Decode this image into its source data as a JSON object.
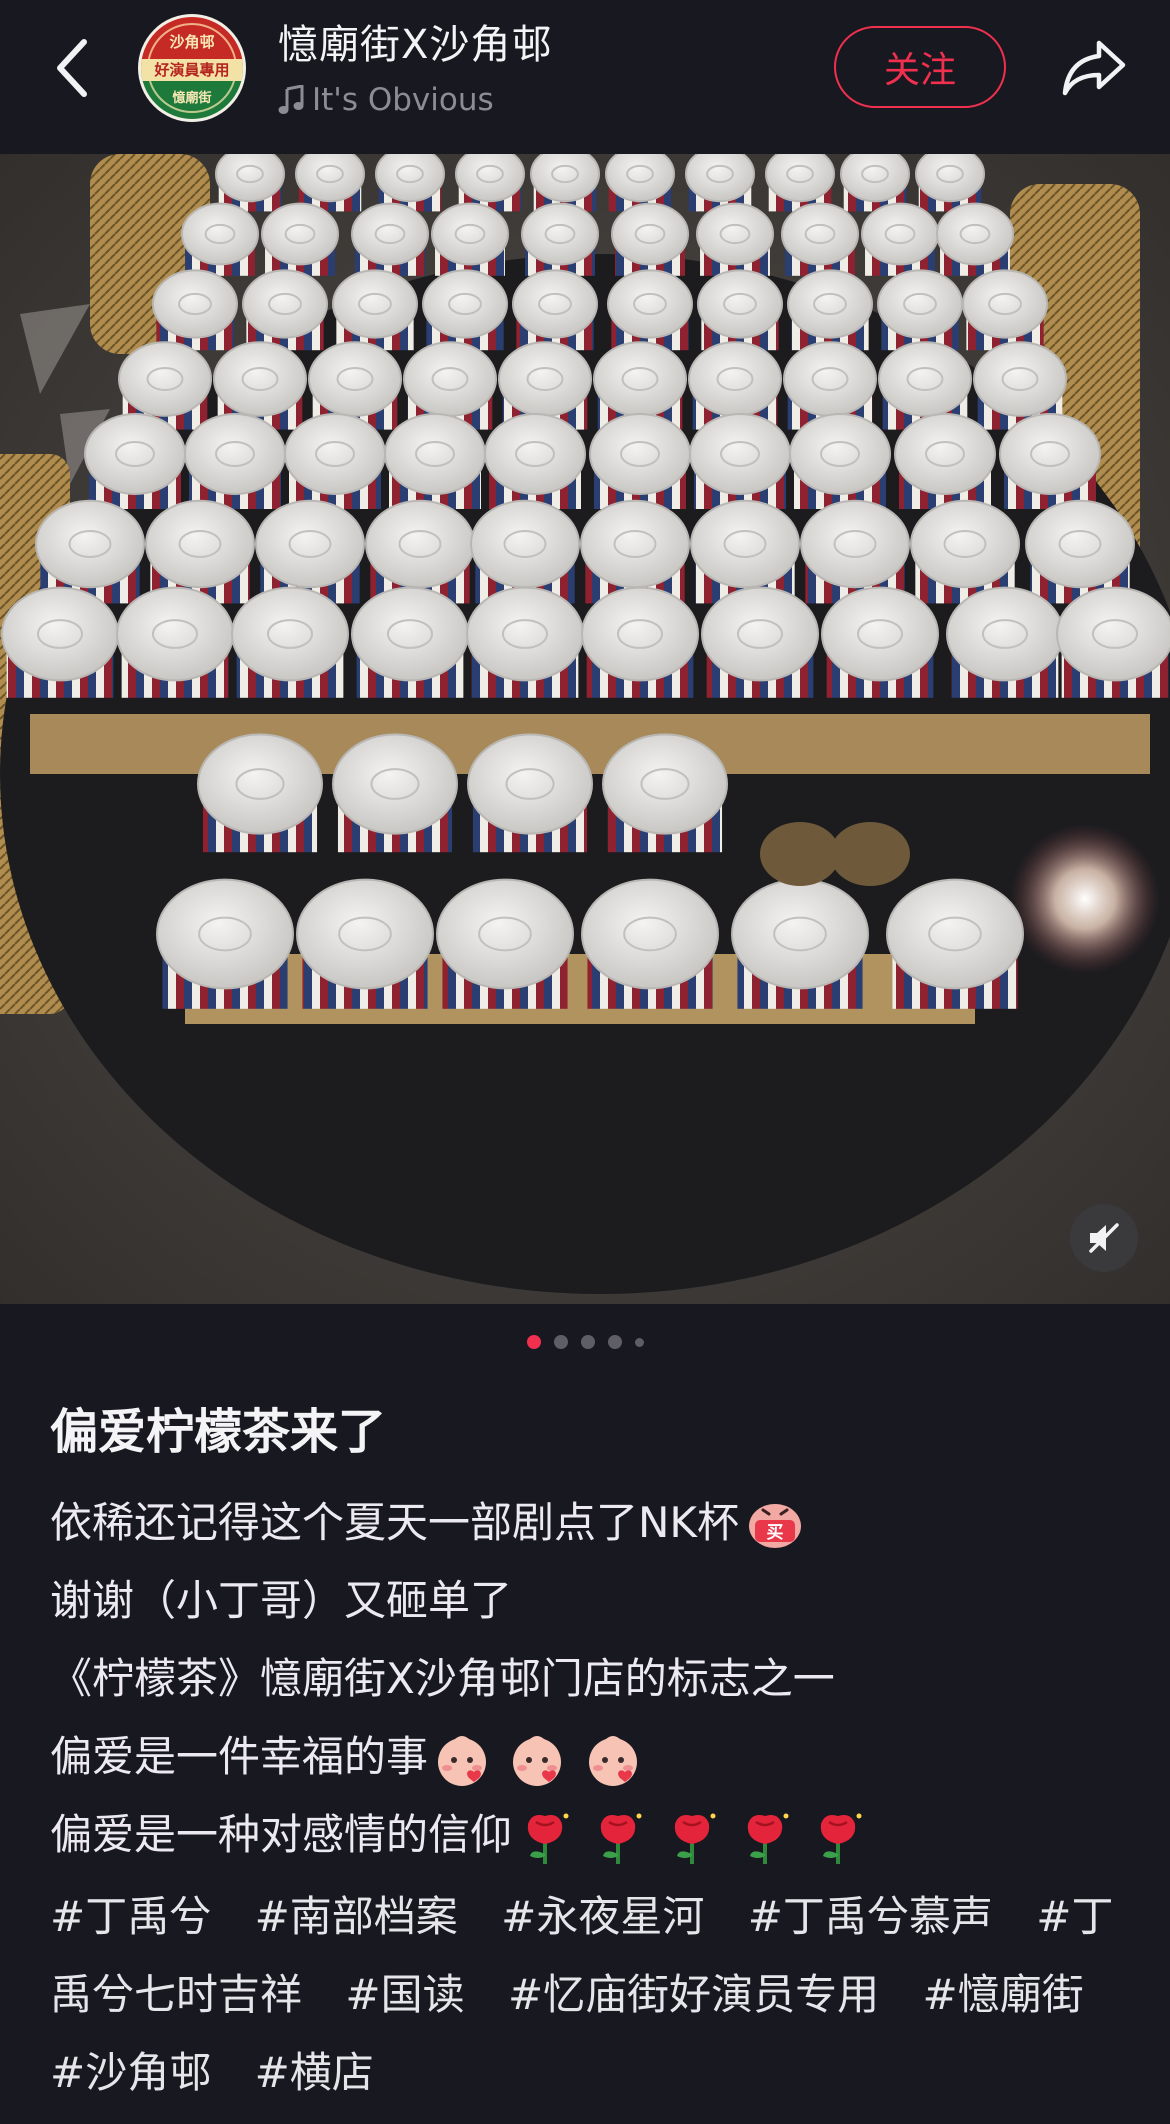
{
  "header": {
    "account_name": "憶廟街X沙角邨",
    "music_title": "It's Obvious",
    "follow_label": "关注",
    "avatar_top": "沙角邨",
    "avatar_band": "好演員專用",
    "avatar_bottom": "憶廟街"
  },
  "carousel": {
    "total": 5,
    "active_index": 0
  },
  "post": {
    "title": "偏爱柠檬茶来了",
    "lines": [
      "依稀还记得这个夏天一部剧点了NK杯",
      "谢谢（小丁哥）又砸单了",
      "《柠檬茶》憶廟街X沙角邨门店的标志之一",
      "偏爱是一件幸福的事",
      "偏爱是一种对感情的信仰"
    ],
    "sticker_buy": "买",
    "tags": [
      "#丁禹兮",
      "#南部档案",
      "#永夜星河",
      "#丁禹兮慕声",
      "#丁禹兮七时吉祥",
      "#国读",
      "#忆庙街好演员专用",
      "#憶廟街",
      "#沙角邨",
      "#横店"
    ]
  },
  "colors": {
    "background": "#181820",
    "accent": "#f0304e",
    "muted_text": "#8d8c95"
  },
  "icons": [
    "back-arrow-icon",
    "music-note-icon",
    "share-icon",
    "mute-icon"
  ]
}
